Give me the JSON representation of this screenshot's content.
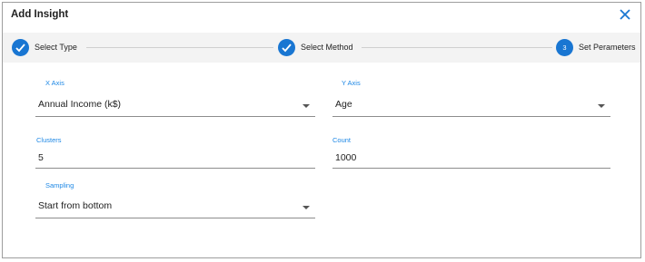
{
  "dialog": {
    "title": "Add Insight",
    "close_icon": "close-icon"
  },
  "stepper": {
    "steps": [
      {
        "label": "Select Type",
        "state": "completed",
        "icon": "check-icon"
      },
      {
        "label": "Select Method",
        "state": "completed",
        "icon": "check-icon"
      },
      {
        "label": "Set Perameters",
        "state": "active",
        "number": "3"
      }
    ]
  },
  "form": {
    "x_axis": {
      "label": "X Axis",
      "value": "Annual Income (k$)"
    },
    "y_axis": {
      "label": "Y Axis",
      "value": "Age"
    },
    "clusters": {
      "label": "Clusters",
      "value": "5"
    },
    "count": {
      "label": "Count",
      "value": "1000"
    },
    "sampling": {
      "label": "Sampling",
      "value": "Start from bottom"
    }
  },
  "colors": {
    "accent": "#1976d2",
    "label": "#1e88e5",
    "stepper_bg": "#f3f3f3"
  }
}
